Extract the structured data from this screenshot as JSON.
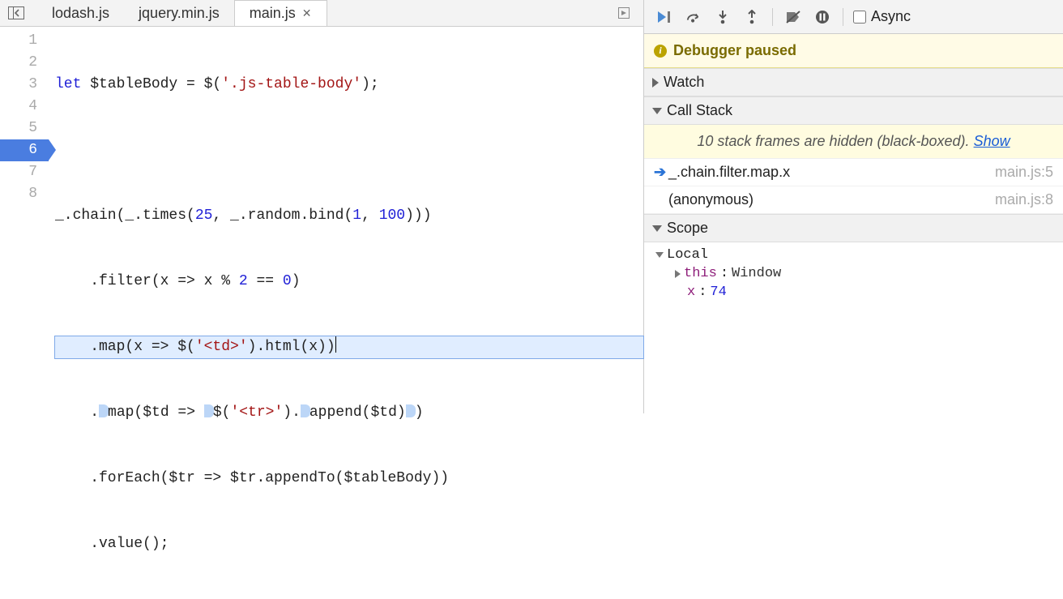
{
  "tabs": [
    {
      "label": "lodash.js",
      "active": false
    },
    {
      "label": "jquery.min.js",
      "active": false
    },
    {
      "label": "main.js",
      "active": true
    }
  ],
  "code": {
    "line1": {
      "kw": "let",
      "rest": " $tableBody = $(",
      "str": "'.js-table-body'",
      "tail": ");"
    },
    "line3_a": "_.chain(_.times(",
    "line3_n1": "25",
    "line3_b": ", _.random.bind(",
    "line3_n2": "1",
    "line3_c": ", ",
    "line3_n3": "100",
    "line3_d": ")))",
    "line4_a": "    .filter(x => x % ",
    "line4_n1": "2",
    "line4_b": " == ",
    "line4_n2": "0",
    "line4_c": ")",
    "line5_a": "    .map(x => $(",
    "line5_s": "'<td>'",
    "line5_b": ").html(x))",
    "line6_a": "    .",
    "line6_b": "map($td => ",
    "line6_c": "$(",
    "line6_s": "'<tr>'",
    "line6_d": ").",
    "line6_e": "append($td)",
    "line6_f": ")",
    "line7": "    .forEach($tr => $tr.appendTo($tableBody))",
    "line8": "    .value();",
    "line_numbers": [
      "1",
      "2",
      "3",
      "4",
      "5",
      "6",
      "7",
      "8"
    ]
  },
  "debugger": {
    "paused_label": "Debugger paused",
    "async_label": "Async",
    "panels": {
      "watch": "Watch",
      "callstack": "Call Stack",
      "scope": "Scope"
    },
    "hidden_frames_text": "10 stack frames are hidden (black-boxed). ",
    "hidden_frames_link": "Show",
    "frames": [
      {
        "name": "_.chain.filter.map.x",
        "loc": "main.js:5",
        "current": true
      },
      {
        "name": "(anonymous)",
        "loc": "main.js:8",
        "current": false
      }
    ],
    "scope": {
      "local_label": "Local",
      "this_key": "this",
      "this_val": "Window",
      "x_key": "x",
      "x_val": "74"
    }
  }
}
